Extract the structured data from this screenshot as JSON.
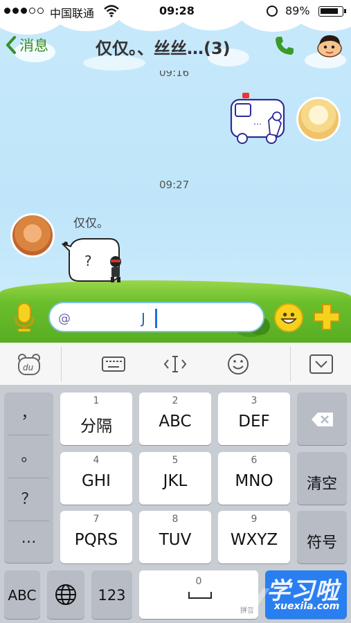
{
  "status_bar": {
    "carrier": "中国联通",
    "time": "09:28",
    "battery_percent": "89%",
    "battery_level": 0.89
  },
  "nav": {
    "back_label": "消息",
    "title": "仅仅。、丝丝…(3)"
  },
  "messages": {
    "timestamp_1": "09:16",
    "timestamp_2": "09:27",
    "sender_name": "仅仅。",
    "sticker_in_text": "?"
  },
  "input": {
    "prefix": "@",
    "value": "J"
  },
  "keyboard": {
    "punctuation": [
      "，",
      "。",
      "？",
      "…"
    ],
    "keys": [
      {
        "num": "1",
        "label": "分隔"
      },
      {
        "num": "2",
        "label": "ABC"
      },
      {
        "num": "3",
        "label": "DEF"
      },
      {
        "num": "4",
        "label": "GHI"
      },
      {
        "num": "5",
        "label": "JKL"
      },
      {
        "num": "6",
        "label": "MNO"
      },
      {
        "num": "7",
        "label": "PQRS"
      },
      {
        "num": "8",
        "label": "TUV"
      },
      {
        "num": "9",
        "label": "WXYZ"
      }
    ],
    "clear_label": "清空",
    "symbols_label": "符号",
    "abc_label": "ABC",
    "num_label": "123",
    "zero_num": "0",
    "space_hint": "拼音",
    "watermark_text": "学习啦",
    "watermark_url": "xuexila.com"
  },
  "colors": {
    "accent_green": "#3a8f24",
    "caret_blue": "#1e6fe0",
    "return_blue": "#2a7ff0"
  }
}
